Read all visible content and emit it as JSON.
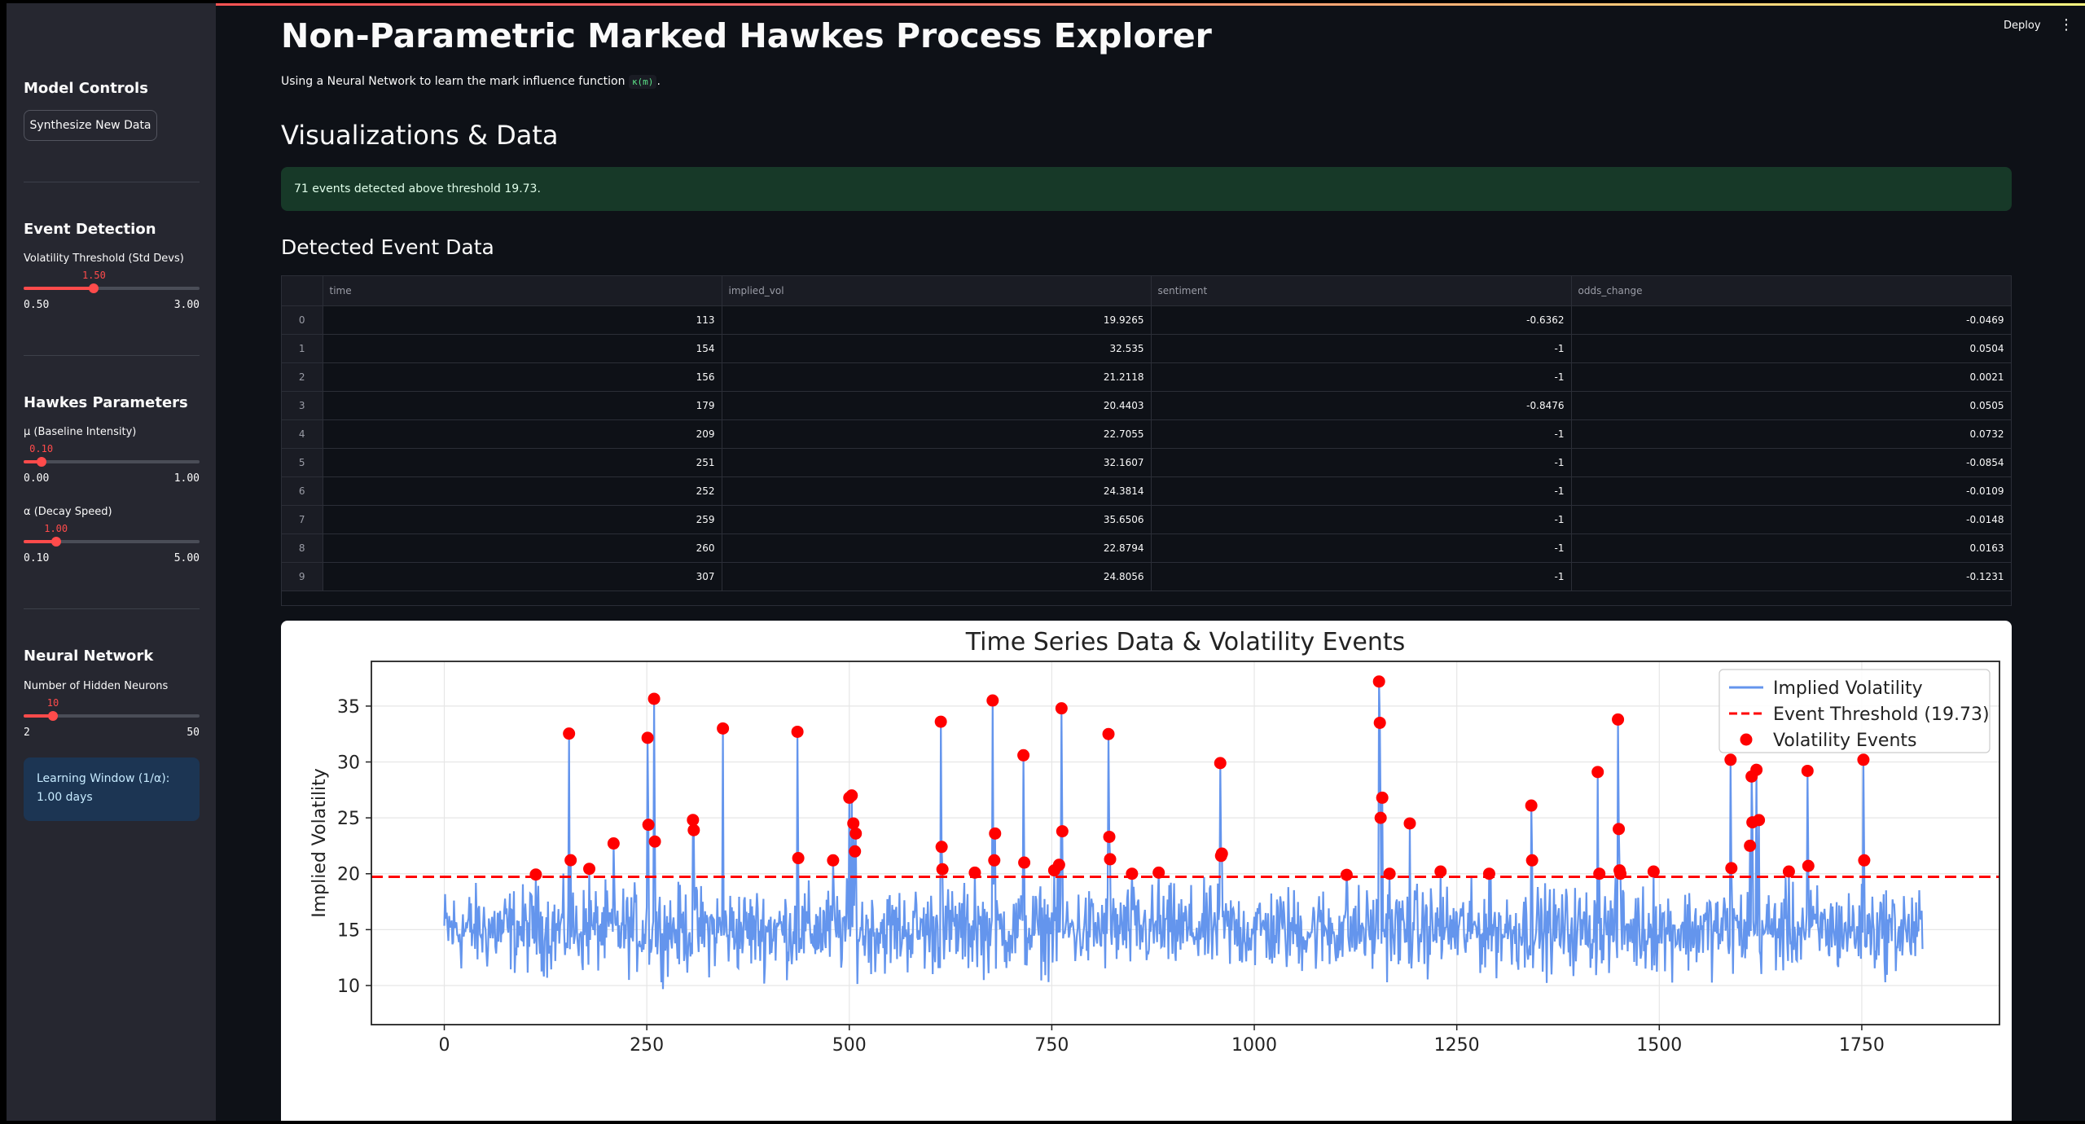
{
  "header": {
    "deploy_label": "Deploy",
    "menu_icon": "⋮"
  },
  "sidebar": {
    "model_controls": "Model Controls",
    "synthesize_label": "Synthesize New Data",
    "event_detection": "Event Detection",
    "vol_threshold": {
      "label": "Volatility Threshold (Std Devs)",
      "value": "1.50",
      "min": "0.50",
      "max": "3.00",
      "fraction": 0.4
    },
    "hawkes_params": "Hawkes Parameters",
    "mu": {
      "label": "μ (Baseline Intensity)",
      "value": "0.10",
      "min": "0.00",
      "max": "1.00",
      "fraction": 0.1
    },
    "alpha": {
      "label": "α (Decay Speed)",
      "value": "1.00",
      "min": "0.10",
      "max": "5.00",
      "fraction": 0.1837
    },
    "neural_network": "Neural Network",
    "neurons": {
      "label": "Number of Hidden Neurons",
      "value": "10",
      "min": "2",
      "max": "50",
      "fraction": 0.1667
    },
    "info_line1": "Learning Window (1/α):",
    "info_line2": "1.00 days"
  },
  "main": {
    "title": "Non-Parametric Marked Hawkes Process Explorer",
    "subtitle_text": "Using a Neural Network to learn the mark influence function",
    "subtitle_code": "κ(m)",
    "subtitle_end": ".",
    "vis_heading": "Visualizations & Data",
    "success_message": "71 events detected above threshold 19.73.",
    "table_heading": "Detected Event Data",
    "table": {
      "columns": [
        "time",
        "implied_vol",
        "sentiment",
        "odds_change"
      ],
      "rows": [
        [
          "0",
          "113",
          "19.9265",
          "-0.6362",
          "-0.0469"
        ],
        [
          "1",
          "154",
          "32.535",
          "-1",
          "0.0504"
        ],
        [
          "2",
          "156",
          "21.2118",
          "-1",
          "0.0021"
        ],
        [
          "3",
          "179",
          "20.4403",
          "-0.8476",
          "0.0505"
        ],
        [
          "4",
          "209",
          "22.7055",
          "-1",
          "0.0732"
        ],
        [
          "5",
          "251",
          "32.1607",
          "-1",
          "-0.0854"
        ],
        [
          "6",
          "252",
          "24.3814",
          "-1",
          "-0.0109"
        ],
        [
          "7",
          "259",
          "35.6506",
          "-1",
          "-0.0148"
        ],
        [
          "8",
          "260",
          "22.8794",
          "-1",
          "0.0163"
        ],
        [
          "9",
          "307",
          "24.8056",
          "-1",
          "-0.1231"
        ]
      ]
    }
  },
  "colors": {
    "accent": "#ff4b4b",
    "line": "#6495ed",
    "event": "#ff0000",
    "success_bg": "#173928",
    "info_bg": "#1c3553"
  },
  "chart_data": {
    "type": "line",
    "title": "Time Series Data & Volatility Events",
    "xlabel": "",
    "ylabel": "Implied Volatility",
    "xlim": [
      -90,
      1920
    ],
    "ylim": [
      6.5,
      39
    ],
    "xticks": [
      0,
      250,
      500,
      750,
      1000,
      1250,
      1500,
      1750
    ],
    "yticks": [
      10,
      15,
      20,
      25,
      30,
      35
    ],
    "grid": true,
    "legend_position": "top-right",
    "threshold": 19.73,
    "series": [
      {
        "name": "Implied Volatility",
        "style": "line",
        "x_range": [
          0,
          1825
        ],
        "baseline_mean": 15,
        "baseline_range": [
          9,
          20.5
        ]
      },
      {
        "name": "Event Threshold (19.73)",
        "style": "dashed",
        "value": 19.73
      },
      {
        "name": "Volatility Events",
        "style": "scatter",
        "points": [
          [
            113,
            19.93
          ],
          [
            154,
            32.54
          ],
          [
            156,
            21.21
          ],
          [
            179,
            20.44
          ],
          [
            209,
            22.71
          ],
          [
            251,
            32.16
          ],
          [
            252,
            24.38
          ],
          [
            259,
            35.65
          ],
          [
            260,
            22.88
          ],
          [
            307,
            24.81
          ],
          [
            308,
            23.9
          ],
          [
            344,
            33.0
          ],
          [
            436,
            32.7
          ],
          [
            437,
            21.4
          ],
          [
            480,
            21.2
          ],
          [
            500,
            26.8
          ],
          [
            503,
            27.0
          ],
          [
            505,
            24.5
          ],
          [
            507,
            22.0
          ],
          [
            508,
            23.6
          ],
          [
            613,
            33.6
          ],
          [
            614,
            22.4
          ],
          [
            615,
            20.4
          ],
          [
            655,
            20.1
          ],
          [
            677,
            35.5
          ],
          [
            679,
            21.2
          ],
          [
            680,
            23.6
          ],
          [
            715,
            30.6
          ],
          [
            716,
            21.0
          ],
          [
            753,
            20.3
          ],
          [
            759,
            20.8
          ],
          [
            762,
            34.8
          ],
          [
            763,
            23.8
          ],
          [
            820,
            32.5
          ],
          [
            821,
            23.3
          ],
          [
            822,
            21.3
          ],
          [
            849,
            20.0
          ],
          [
            882,
            20.1
          ],
          [
            958,
            29.9
          ],
          [
            959,
            21.6
          ],
          [
            960,
            21.8
          ],
          [
            1114,
            19.9
          ],
          [
            1154,
            37.2
          ],
          [
            1155,
            33.5
          ],
          [
            1156,
            25.0
          ],
          [
            1158,
            26.8
          ],
          [
            1167,
            20.0
          ],
          [
            1192,
            24.5
          ],
          [
            1230,
            20.2
          ],
          [
            1290,
            20.0
          ],
          [
            1342,
            26.1
          ],
          [
            1343,
            21.2
          ],
          [
            1424,
            29.1
          ],
          [
            1426,
            20.0
          ],
          [
            1449,
            33.8
          ],
          [
            1450,
            24.0
          ],
          [
            1451,
            20.3
          ],
          [
            1452,
            20.0
          ],
          [
            1493,
            20.2
          ],
          [
            1588,
            30.2
          ],
          [
            1589,
            20.5
          ],
          [
            1612,
            22.5
          ],
          [
            1614,
            28.7
          ],
          [
            1615,
            24.6
          ],
          [
            1620,
            29.3
          ],
          [
            1623,
            24.8
          ],
          [
            1660,
            20.2
          ],
          [
            1683,
            29.2
          ],
          [
            1684,
            20.7
          ],
          [
            1752,
            30.2
          ],
          [
            1753,
            21.2
          ]
        ]
      }
    ]
  }
}
